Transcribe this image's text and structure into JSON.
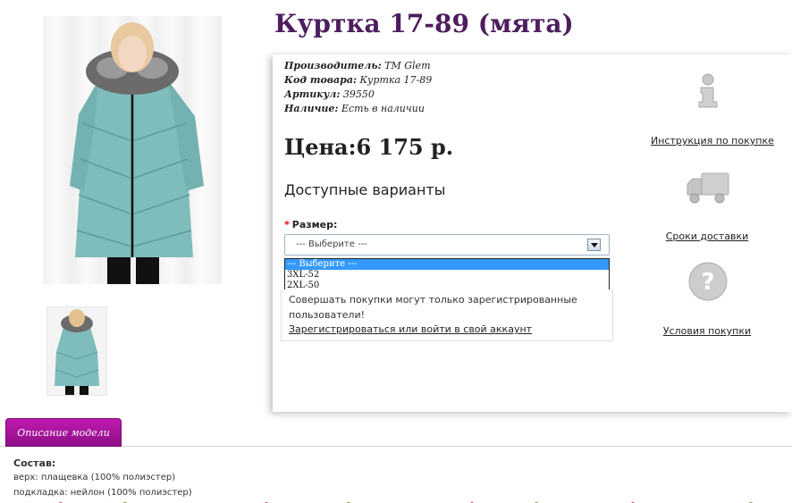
{
  "product": {
    "title": "Куртка 17-89 (мята)"
  },
  "meta": [
    {
      "label": "Производитель:",
      "value": " TM Glem"
    },
    {
      "label": "Код товара:",
      "value": " Куртка 17-89"
    },
    {
      "label": "Артикул:",
      "value": " 39550"
    },
    {
      "label": "Наличие:",
      "value": " Есть в наличии"
    }
  ],
  "price": "Цена:6 175 р.",
  "variants_title": "Доступные варианты",
  "size": {
    "required_mark": "*",
    "label": "Размер:",
    "selected": "--- Выберите ---",
    "options": [
      "--- Выберите ---",
      "3XL-52",
      "2XL-50"
    ]
  },
  "notice": {
    "text": "Совершать покупки могут только зарегистрированные пользователи!",
    "link": "Зарегистрироваться или войти в свой аккаунт"
  },
  "side_links": {
    "instructions": "Инструкция по покупке",
    "delivery": "Сроки доставки",
    "terms": "Условия покупки"
  },
  "description": {
    "tab_label": "Описание модели",
    "heading": "Состав:",
    "lines": [
      "верх: плащевка (100% полиэстер)",
      "подкладка: нейлон (100% полиэстер)"
    ]
  },
  "colors": {
    "title": "#4d1d5e",
    "tab": "#a8149c",
    "jacket": "#7fbcbc",
    "dropdown_highlight": "#3399ff"
  }
}
